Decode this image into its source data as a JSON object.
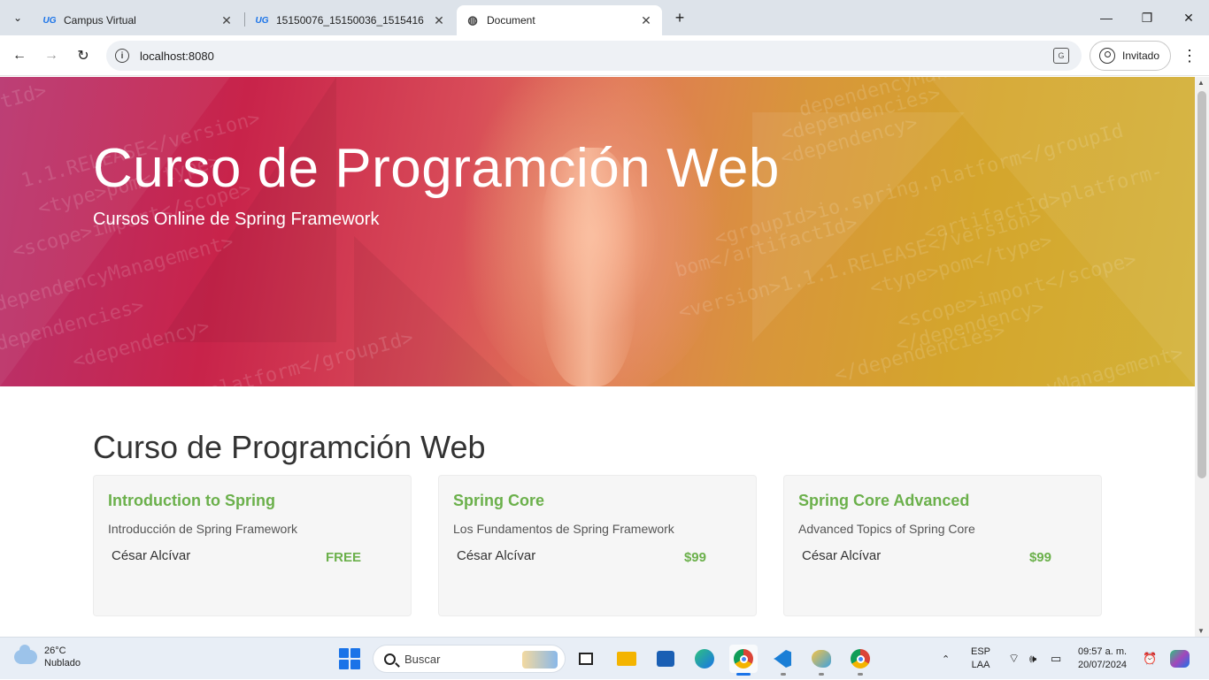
{
  "browser": {
    "tabs": [
      {
        "title": "Campus Virtual",
        "favicon": "UG",
        "active": false
      },
      {
        "title": "15150076_15150036_1515416",
        "favicon": "UG",
        "active": false
      },
      {
        "title": "Document",
        "favicon": "globe-icon",
        "active": true
      }
    ],
    "url": "localhost:8080",
    "profile_label": "Invitado"
  },
  "hero": {
    "title": "Curso de Programción Web",
    "subtitle": "Cursos Online de Spring Framework",
    "background_code_lines": [
      "tId>",
      "1.1.RELEASE</version>",
      "<type>pom</type>",
      "<scope>import</scope>",
      "dependencyManagement>",
      "<dependencies>",
      "<dependency>",
      "ing.platform</groupId>",
      "dependencyManag",
      "<dependencies>",
      "<dependency>",
      "<groupId>io.spring.platform</groupId",
      "<artifactId>platform-",
      "bom</artifactId>",
      "<version>1.1.1.RELEASE</version>",
      "<type>pom</type>",
      "<scope>import</scope>",
      "</dependency>",
      "</dependencies>",
      "yManagement>"
    ]
  },
  "section": {
    "title": "Curso de Programción Web"
  },
  "courses": [
    {
      "title": "Introduction to Spring",
      "description": "Introducción de Spring Framework",
      "author": "César Alcívar",
      "price": "FREE"
    },
    {
      "title": "Spring Core",
      "description": "Los Fundamentos de Spring Framework",
      "author": "César Alcívar",
      "price": "$99"
    },
    {
      "title": "Spring Core Advanced",
      "description": "Advanced Topics of Spring Core",
      "author": "César Alcívar",
      "price": "$99"
    }
  ],
  "taskbar": {
    "weather_temp": "26°C",
    "weather_desc": "Nublado",
    "search_placeholder": "Buscar",
    "apps": [
      "task-view-icon",
      "file-explorer-icon",
      "store-icon",
      "edge-icon",
      "chrome-icon",
      "vscode-icon",
      "paint-icon",
      "chrome-profile-icon"
    ],
    "lang_top": "ESP",
    "lang_bottom": "LAA",
    "time": "09:57 a. m.",
    "date": "20/07/2024"
  },
  "colors": {
    "accent_green": "#6bb04b",
    "tab_strip": "#dde3ea",
    "card_bg": "#f6f6f6"
  }
}
